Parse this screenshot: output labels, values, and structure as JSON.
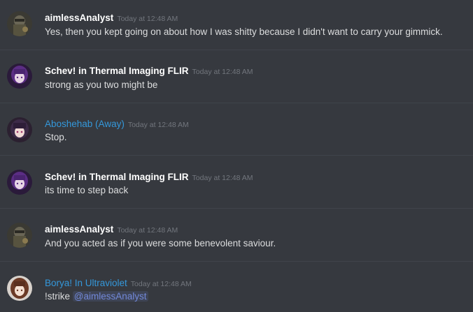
{
  "colors": {
    "background": "#36393f",
    "divider": "#40444b",
    "author_default": "#ffffff",
    "author_role_blue": "#3498db",
    "timestamp": "#72767d",
    "message_text": "#dcddde",
    "mention": "#7289da"
  },
  "messages": [
    {
      "author": "aimlessAnalyst",
      "timestamp": "Today at 12:48 AM",
      "text": "Yes, then you kept going on about how I was shitty because I didn't want to carry your gimmick.",
      "avatar_icon": "soldier-avatar-icon"
    },
    {
      "author": "Schev! in Thermal Imaging FLIR",
      "timestamp": "Today at 12:48 AM",
      "text": "strong as you two might be",
      "avatar_icon": "purple-anime-avatar-icon"
    },
    {
      "author": "Aboshehab (Away)",
      "timestamp": "Today at 12:48 AM",
      "text": "Stop.",
      "avatar_icon": "dark-haired-avatar-icon"
    },
    {
      "author": "Schev! in Thermal Imaging FLIR",
      "timestamp": "Today at 12:48 AM",
      "text": "its time to step back",
      "avatar_icon": "purple-anime-avatar-icon"
    },
    {
      "author": "aimlessAnalyst",
      "timestamp": "Today at 12:48 AM",
      "text": "And you acted as if you were some benevolent saviour.",
      "avatar_icon": "soldier-avatar-icon"
    },
    {
      "author": "Borya! In Ultraviolet",
      "timestamp": "Today at 12:48 AM",
      "text": "!strike",
      "mention": "@aimlessAnalyst",
      "avatar_icon": "brown-haired-avatar-icon"
    }
  ]
}
